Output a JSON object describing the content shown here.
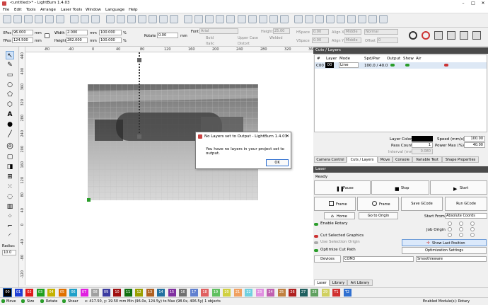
{
  "window": {
    "title": "<untitled>* - LightBurn 1.4.03"
  },
  "menu": [
    "File",
    "Edit",
    "Tools",
    "Arrange",
    "Laser Tools",
    "Window",
    "Language",
    "Help"
  ],
  "toolbar2": {
    "xpos_label": "XPos",
    "xpos": "96.000",
    "ypos_label": "YPos",
    "ypos": "124.500",
    "width_label": "Width",
    "width": "2.000",
    "height_label": "Height",
    "height": "282.000",
    "unit": "mm",
    "pct1": "100.000",
    "pct2": "100.000",
    "pct_sign": "%",
    "rotate_label": "Rotate",
    "rotate": "0.00",
    "rotate_unit": "mm",
    "font_label": "Font",
    "font": "Arial",
    "height_f_label": "Height",
    "height_f": "25.00",
    "hspace_label": "HSpace",
    "hspace": "0.00",
    "vspace_label": "VSpace",
    "vspace": "0.00",
    "bold": "Bold",
    "italic": "Italic",
    "upper": "Upper Case",
    "distort": "Distort",
    "welded": "Welded",
    "alignx_label": "Align X",
    "alignx": "Middle",
    "aligny_label": "Align Y",
    "aligny": "Middle",
    "normal": "Normal",
    "offset_label": "Offset",
    "offset": "0"
  },
  "rulers": {
    "top": [
      "-80",
      "-40",
      "0",
      "40",
      "80",
      "120",
      "160",
      "200",
      "240",
      "280",
      "320",
      "360"
    ],
    "left": [
      "440",
      "400",
      "360",
      "320",
      "280",
      "240",
      "200",
      "160",
      "120",
      "80",
      "40",
      "0",
      "-40",
      "-80",
      "-120"
    ]
  },
  "left_panel": {
    "radius_label": "Radius:",
    "radius": "10.0"
  },
  "dialog": {
    "title": "No Layers set to Output - LightBurn 1.4.03",
    "message": "You have no layers in your project set to output.",
    "ok": "OK"
  },
  "cuts": {
    "title": "Cuts / Layers",
    "headers": [
      "#",
      "Layer",
      "Mode",
      "Spd/Pwr",
      "Output",
      "Show",
      "Air"
    ],
    "row": {
      "num": "C00",
      "layer": "00",
      "mode": "Line",
      "spd": "100.0 / 40.0"
    },
    "layer_color_label": "Layer Color",
    "pass_label": "Pass Count",
    "pass": "1",
    "interval_label": "Interval (mm)",
    "interval": "0.080",
    "speed_label": "Speed (mm/s)",
    "speed": "100.00",
    "power_label": "Power Max (%)",
    "power": "40.00"
  },
  "tabs1": [
    "Camera Control",
    "Cuts / Layers",
    "Move",
    "Console",
    "Variable Text",
    "Shape Properties"
  ],
  "laser": {
    "title": "Laser",
    "status": "Ready",
    "pause": "Pause",
    "stop": "Stop",
    "start": "Start",
    "frame1": "Frame",
    "frame2": "Frame",
    "save": "Save GCode",
    "run": "Run GCode",
    "home": "Home",
    "origin": "Go to Origin",
    "start_from_label": "Start From:",
    "start_from": "Absolute Coords",
    "job_origin": "Job Origin",
    "enable_rotary": "Enable Rotary",
    "cut_selected": "Cut Selected Graphics",
    "use_sel_origin": "Use Selection Origin",
    "optimize": "Optimize Cut Path",
    "show_last": "Show Last Position",
    "opt_settings": "Optimization Settings",
    "devices": "Devices",
    "port": "COM3",
    "device": "Smoothieware"
  },
  "tabs2": [
    "Laser",
    "Library",
    "Art Library"
  ],
  "palette": [
    {
      "l": "00",
      "c": "#000000"
    },
    {
      "l": "01",
      "c": "#1f3fd6"
    },
    {
      "l": "02",
      "c": "#e01b1b"
    },
    {
      "l": "03",
      "c": "#1fa01f"
    },
    {
      "l": "04",
      "c": "#c4b200"
    },
    {
      "l": "05",
      "c": "#e07000"
    },
    {
      "l": "06",
      "c": "#1fa0c8"
    },
    {
      "l": "07",
      "c": "#e020e0"
    },
    {
      "l": "08",
      "c": "#a0a0a0"
    },
    {
      "l": "09",
      "c": "#3b3ba0"
    },
    {
      "l": "10",
      "c": "#a01010"
    },
    {
      "l": "11",
      "c": "#107010"
    },
    {
      "l": "12",
      "c": "#9aa000"
    },
    {
      "l": "13",
      "c": "#b06020"
    },
    {
      "l": "14",
      "c": "#2070a0"
    },
    {
      "l": "15",
      "c": "#8030a0"
    },
    {
      "l": "16",
      "c": "#707070"
    },
    {
      "l": "17",
      "c": "#6080d0"
    },
    {
      "l": "18",
      "c": "#e06060"
    },
    {
      "l": "19",
      "c": "#60c060"
    },
    {
      "l": "20",
      "c": "#d0d040"
    },
    {
      "l": "21",
      "c": "#f0a060"
    },
    {
      "l": "22",
      "c": "#70d0e0"
    },
    {
      "l": "23",
      "c": "#e090e0"
    },
    {
      "l": "24",
      "c": "#c060b0"
    },
    {
      "l": "25",
      "c": "#c08040"
    },
    {
      "l": "26",
      "c": "#b02020"
    },
    {
      "l": "27",
      "c": "#206060"
    },
    {
      "l": "28",
      "c": "#60a060"
    },
    {
      "l": "29",
      "c": "#d0d060"
    },
    {
      "l": "T1",
      "c": "#d03030"
    },
    {
      "l": "T2",
      "c": "#3070d0"
    }
  ],
  "status": {
    "move": "Move",
    "size": "Size",
    "rotate": "Rotate",
    "shear": "Shear",
    "coords": "x: 417.50, y: 19.50 mm",
    "minmax": "Min (96.0x, 124.5y) to Max (98.0x, 406.5y)  1 objects",
    "modules": "Enabled Module(s): Rotary"
  }
}
